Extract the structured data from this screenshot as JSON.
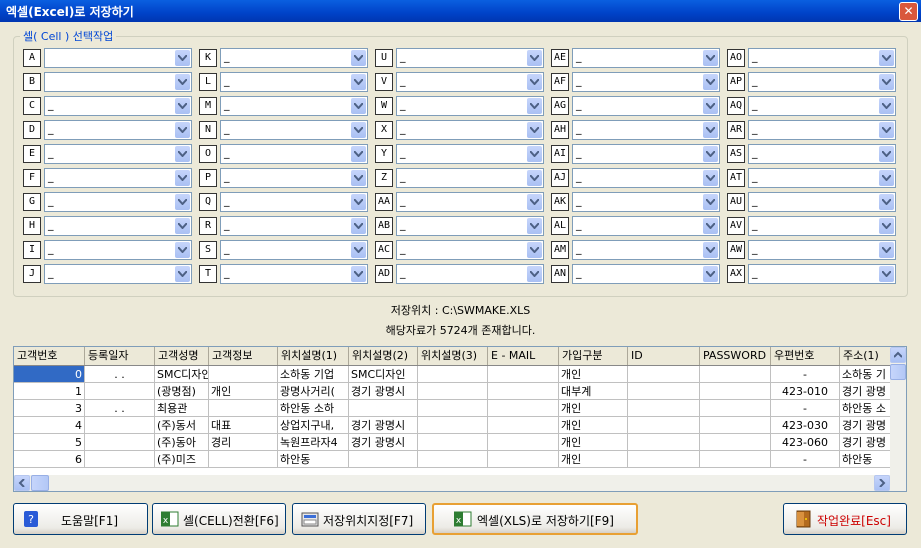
{
  "window": {
    "title": "엑셀(Excel)로 저장하기",
    "close_glyph": "✕"
  },
  "group": {
    "title": "셀( Cell ) 선택작업"
  },
  "columns": [
    [
      {
        "letter": "A",
        "value": ""
      },
      {
        "letter": "B",
        "value": ""
      },
      {
        "letter": "C",
        "value": "_"
      },
      {
        "letter": "D",
        "value": "_"
      },
      {
        "letter": "E",
        "value": "_"
      },
      {
        "letter": "F",
        "value": "_"
      },
      {
        "letter": "G",
        "value": "_"
      },
      {
        "letter": "H",
        "value": "_"
      },
      {
        "letter": "I",
        "value": "_"
      },
      {
        "letter": "J",
        "value": "_"
      }
    ],
    [
      {
        "letter": "K",
        "value": "_"
      },
      {
        "letter": "L",
        "value": "_"
      },
      {
        "letter": "M",
        "value": "_"
      },
      {
        "letter": "N",
        "value": "_"
      },
      {
        "letter": "O",
        "value": "_"
      },
      {
        "letter": "P",
        "value": "_"
      },
      {
        "letter": "Q",
        "value": "_"
      },
      {
        "letter": "R",
        "value": "_"
      },
      {
        "letter": "S",
        "value": "_"
      },
      {
        "letter": "T",
        "value": "_"
      }
    ],
    [
      {
        "letter": "U",
        "value": "_"
      },
      {
        "letter": "V",
        "value": "_"
      },
      {
        "letter": "W",
        "value": "_"
      },
      {
        "letter": "X",
        "value": "_"
      },
      {
        "letter": "Y",
        "value": "_"
      },
      {
        "letter": "Z",
        "value": "_"
      },
      {
        "letter": "AA",
        "value": "_"
      },
      {
        "letter": "AB",
        "value": "_"
      },
      {
        "letter": "AC",
        "value": "_"
      },
      {
        "letter": "AD",
        "value": "_"
      }
    ],
    [
      {
        "letter": "AE",
        "value": "_"
      },
      {
        "letter": "AF",
        "value": "_"
      },
      {
        "letter": "AG",
        "value": "_"
      },
      {
        "letter": "AH",
        "value": "_"
      },
      {
        "letter": "AI",
        "value": "_"
      },
      {
        "letter": "AJ",
        "value": "_"
      },
      {
        "letter": "AK",
        "value": "_"
      },
      {
        "letter": "AL",
        "value": "_"
      },
      {
        "letter": "AM",
        "value": "_"
      },
      {
        "letter": "AN",
        "value": "_"
      }
    ],
    [
      {
        "letter": "AO",
        "value": "_"
      },
      {
        "letter": "AP",
        "value": "_"
      },
      {
        "letter": "AQ",
        "value": "_"
      },
      {
        "letter": "AR",
        "value": "_"
      },
      {
        "letter": "AS",
        "value": "_"
      },
      {
        "letter": "AT",
        "value": "_"
      },
      {
        "letter": "AU",
        "value": "_"
      },
      {
        "letter": "AV",
        "value": "_"
      },
      {
        "letter": "AW",
        "value": "_"
      },
      {
        "letter": "AX",
        "value": "_"
      }
    ]
  ],
  "info": {
    "save_location": "저장위치 : C:\\SWMAKE.XLS",
    "record_count": "해당자료가 5724개 존재합니다."
  },
  "table": {
    "headers": [
      "고객번호",
      "등록일자",
      "고객성명",
      "고객정보",
      "위치설명(1)",
      "위치설명(2)",
      "위치설명(3)",
      "E - MAIL",
      "가입구분",
      "ID",
      "PASSWORD",
      "우편번호",
      "주소(1)"
    ],
    "rows": [
      [
        "0",
        ". .",
        "SMC디자인",
        "",
        "소하동 기업",
        "SMC디자인",
        "",
        "",
        "개인",
        "",
        "",
        "-",
        "소하동 기"
      ],
      [
        "1",
        "",
        "(광명점)",
        "개인",
        "광명사거리(",
        "경기 광명시",
        "",
        "",
        "대부계",
        "",
        "",
        "423-010",
        "경기 광명"
      ],
      [
        "3",
        ". .",
        "최용관",
        "",
        "하안동 소하",
        "",
        "",
        "",
        "개인",
        "",
        "",
        "-",
        "하안동 소"
      ],
      [
        "4",
        "",
        "(주)동서",
        "대표",
        "상업지구내,",
        "경기 광명시",
        "",
        "",
        "개인",
        "",
        "",
        "423-030",
        "경기 광명"
      ],
      [
        "5",
        "",
        "(주)동아",
        "경리",
        "녹원프라자4",
        "경기 광명시",
        "",
        "",
        "개인",
        "",
        "",
        "423-060",
        "경기 광명"
      ],
      [
        "6",
        "",
        "(주)미즈",
        "",
        "하안동",
        "",
        "",
        "",
        "개인",
        "",
        "",
        "-",
        "하안동"
      ]
    ]
  },
  "buttons": {
    "help": "도움말[F1]",
    "cell_convert": "셀(CELL)전환[F6]",
    "set_location": "저장위치지정[F7]",
    "save_xls": "엑셀(XLS)로 저장하기[F9]",
    "done": "작업완료[Esc]"
  },
  "colors": {
    "title_bar": "#0a5fe0",
    "selection": "#316ac5",
    "group_title": "#0046d5",
    "done_text": "#cc0000"
  }
}
